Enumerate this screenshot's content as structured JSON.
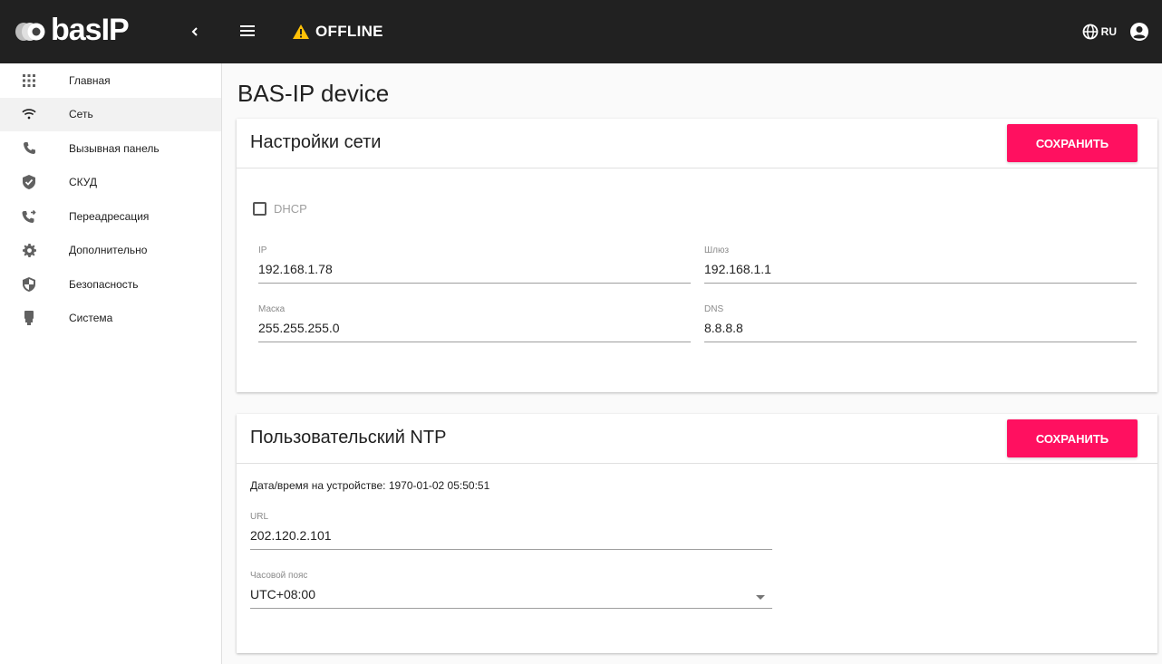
{
  "header": {
    "logo_text": "basIP",
    "status_text": "OFFLINE",
    "lang": "RU"
  },
  "sidebar": {
    "items": [
      {
        "label": "Главная",
        "icon": "apps-grid-icon"
      },
      {
        "label": "Сеть",
        "icon": "wifi-icon"
      },
      {
        "label": "Вызывная панель",
        "icon": "phone-icon"
      },
      {
        "label": "СКУД",
        "icon": "shield-check-icon"
      },
      {
        "label": "Переадресация",
        "icon": "phone-forward-icon"
      },
      {
        "label": "Дополнительно",
        "icon": "gear-icon"
      },
      {
        "label": "Безопасность",
        "icon": "security-shield-icon"
      },
      {
        "label": "Система",
        "icon": "system-icon"
      }
    ],
    "active_index": 1
  },
  "main": {
    "page_title": "BAS-IP device",
    "network_card": {
      "title": "Настройки сети",
      "save_label": "СОХРАНИТЬ",
      "dhcp_label": "DHCP",
      "dhcp_checked": false,
      "ip": {
        "label": "IP",
        "value": "192.168.1.78"
      },
      "gateway": {
        "label": "Шлюз",
        "value": "192.168.1.1"
      },
      "mask": {
        "label": "Маска",
        "value": "255.255.255.0"
      },
      "dns": {
        "label": "DNS",
        "value": "8.8.8.8"
      }
    },
    "ntp_card": {
      "title": "Пользовательский NTP",
      "save_label": "СОХРАНИТЬ",
      "device_time": "Дата/время на устройстве: 1970-01-02 05:50:51",
      "url": {
        "label": "URL",
        "value": "202.120.2.101"
      },
      "timezone": {
        "label": "Часовой пояс",
        "value": "UTC+08:00"
      }
    }
  },
  "colors": {
    "topbar": "#212121",
    "accent": "#ff1060",
    "warning": "#ffc107"
  }
}
